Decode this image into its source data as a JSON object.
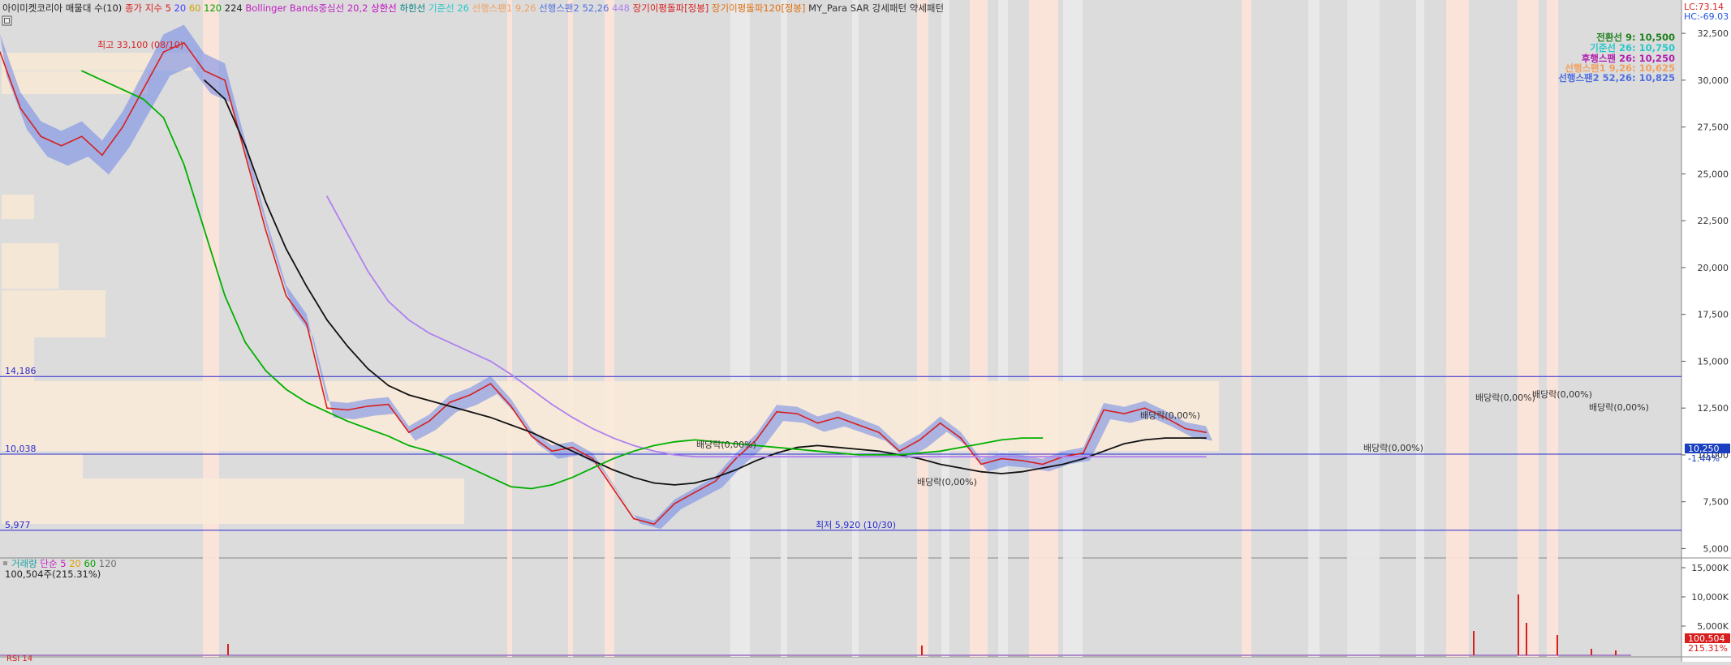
{
  "legend_top": [
    {
      "text": "아이미켓코리아 매물대 수(10)",
      "color": "#222222"
    },
    {
      "text": "종가 지수 5",
      "color": "#d81e1e"
    },
    {
      "text": "20",
      "color": "#4040ff"
    },
    {
      "text": "60",
      "color": "#d4a000"
    },
    {
      "text": "120",
      "color": "#00a000"
    },
    {
      "text": "224",
      "color": "#222222"
    },
    {
      "text": "Bollinger Bands중심선 20,2",
      "color": "#c020c0"
    },
    {
      "text": "상한선",
      "color": "#c000c0"
    },
    {
      "text": "하한선",
      "color": "#008080"
    },
    {
      "text": "기준선 26",
      "color": "#28c8c8"
    },
    {
      "text": "선행스팬1 9,26",
      "color": "#f0a060"
    },
    {
      "text": "선행스팬2 52,26",
      "color": "#5070e0"
    },
    {
      "text": "448",
      "color": "#b080f0"
    },
    {
      "text": "장기이평돌파[정봉]",
      "color": "#d81e1e"
    },
    {
      "text": "장기이평돌파120[정봉]",
      "color": "#e07010"
    },
    {
      "text": "MY_Para SAR 강세패턴",
      "color": "#333333"
    },
    {
      "text": "약세패턴",
      "color": "#333333"
    }
  ],
  "right_top_labels": [
    {
      "text": "LC:73.14",
      "color": "#d81e1e"
    },
    {
      "text": "HC:-69.03",
      "color": "#2050e0"
    }
  ],
  "ichimoku_box": [
    {
      "text": "전환선 9: 10,500",
      "color": "#208020"
    },
    {
      "text": "기준선 26: 10,750",
      "color": "#28c8c8"
    },
    {
      "text": "후행스팬 26: 10,250",
      "color": "#b020b0"
    },
    {
      "text": "선행스팬1 9,26: 10,625",
      "color": "#f0a060"
    },
    {
      "text": "선행스팬2 52,26: 10,825",
      "color": "#5070e0"
    }
  ],
  "annotations": {
    "high": "최고 33,100 (08/10)",
    "low": "최저 5,920 (10/30)",
    "dividends": [
      "배당락(0,00%)",
      "배당락(0,00%)",
      "배당락(0,00%)",
      "배당락(0,00%)",
      "배당락(0,00%)",
      "배당락(0,00%)",
      "배당락(0,00%)"
    ]
  },
  "hlines": [
    {
      "label": "14,186",
      "value": 14186
    },
    {
      "label": "10,038",
      "value": 10038
    },
    {
      "label": "5,977",
      "value": 5977
    }
  ],
  "price_axis": [
    "32,500",
    "30,000",
    "27,500",
    "25,000",
    "22,500",
    "20,000",
    "17,500",
    "15,000",
    "12,500",
    "10,000",
    "7,500",
    "5,000"
  ],
  "price_badge": {
    "value": "10,250",
    "change": "-1.44%"
  },
  "volume_legend": [
    {
      "text": "거래량",
      "color": "#20a0a0"
    },
    {
      "text": "단순 5",
      "color": "#c020c0"
    },
    {
      "text": "20",
      "color": "#e0a000"
    },
    {
      "text": "60",
      "color": "#00a000"
    },
    {
      "text": "120",
      "color": "#707070"
    }
  ],
  "volume_info": "100,504주(215.31%)",
  "volume_axis": [
    "15,000K",
    "10,000K",
    "5,000K"
  ],
  "volume_badge": {
    "value": "100,504",
    "change": "215.31%"
  },
  "bottom_legend": "RSI 14",
  "chart_data": {
    "type": "line",
    "title": "아이미켓코리아",
    "ylim": [
      4500,
      33500
    ],
    "y_ticks": [
      32500,
      30000,
      27500,
      25000,
      22500,
      20000,
      17500,
      15000,
      12500,
      10000,
      7500,
      5000
    ],
    "x": [
      0,
      25,
      50,
      75,
      100,
      125,
      150,
      175,
      200,
      225,
      250,
      275,
      300,
      325,
      350,
      375,
      400,
      425,
      450,
      475,
      500,
      525,
      550,
      575,
      600,
      625,
      650,
      675,
      700,
      725,
      750,
      775,
      800,
      825,
      850,
      875,
      900,
      925,
      950,
      975,
      1000,
      1025,
      1050,
      1075,
      1100,
      1125,
      1150,
      1175,
      1200,
      1225,
      1250,
      1275,
      1300,
      1325,
      1350,
      1375,
      1400,
      1425,
      1450,
      1475,
      1500,
      1525,
      1550,
      1575,
      1600,
      1625,
      1650,
      1675,
      1700,
      1725,
      1750,
      1775,
      1800,
      1825,
      1850,
      1875,
      1900,
      1925,
      1950,
      1975,
      2000
    ],
    "series": [
      {
        "name": "종가",
        "color": "#d81e1e",
        "values": [
          31500,
          28500,
          27000,
          26500,
          27000,
          26000,
          27500,
          29500,
          31500,
          32000,
          30500,
          30000,
          26000,
          22000,
          18500,
          17000,
          12500,
          12400,
          12600,
          12700,
          11200,
          11800,
          12800,
          13200,
          13800,
          12600,
          11000,
          10200,
          10400,
          9800,
          8200,
          6600,
          6300,
          7400,
          8000,
          8600,
          9800,
          10800,
          12300,
          12200,
          11700,
          12000,
          11600,
          11200,
          10200,
          10800,
          11700,
          10900,
          9500,
          9800,
          9700,
          9500,
          9900,
          10100,
          12400,
          12200,
          12500,
          12000,
          11400,
          11200
        ]
      },
      {
        "name": "224",
        "color": "#111111",
        "values": [
          null,
          null,
          null,
          null,
          null,
          null,
          null,
          null,
          null,
          null,
          30000,
          29000,
          26500,
          23500,
          21000,
          19000,
          17200,
          15800,
          14600,
          13700,
          13200,
          12900,
          12600,
          12300,
          12000,
          11600,
          11200,
          10700,
          10200,
          9700,
          9200,
          8800,
          8500,
          8400,
          8500,
          8800,
          9200,
          9700,
          10100,
          10400,
          10500,
          10400,
          10300,
          10200,
          10000,
          9800,
          9500,
          9300,
          9100,
          9000,
          9100,
          9300,
          9500,
          9800,
          10200,
          10600,
          10800,
          10900,
          10900,
          10900
        ]
      },
      {
        "name": "448",
        "color": "#b080f0",
        "values": [
          null,
          null,
          null,
          null,
          null,
          null,
          null,
          null,
          null,
          null,
          null,
          null,
          null,
          null,
          null,
          null,
          23800,
          21800,
          19800,
          18200,
          17200,
          16500,
          16000,
          15500,
          15000,
          14300,
          13500,
          12700,
          12000,
          11400,
          10900,
          10500,
          10200,
          10000,
          9900,
          9900,
          9900,
          9900,
          9900,
          9900,
          9900,
          9900,
          9900,
          9900,
          9900,
          9900,
          9900,
          9900,
          9900,
          9900,
          9900,
          9900,
          9900,
          9900,
          9900,
          9900,
          9900,
          9900,
          9900,
          9900
        ]
      },
      {
        "name": "120",
        "color": "#00b000",
        "values": [
          null,
          null,
          null,
          null,
          30500,
          30000,
          29500,
          29000,
          28000,
          25500,
          22000,
          18500,
          16000,
          14500,
          13500,
          12800,
          12300,
          11800,
          11400,
          11000,
          10500,
          10200,
          9800,
          9300,
          8800,
          8300,
          8200,
          8400,
          8800,
          9300,
          9800,
          10200,
          10500,
          10700,
          10800,
          10700,
          10600,
          10500,
          10400,
          10300,
          10200,
          10100,
          10000,
          10000,
          10000,
          10100,
          10200,
          10400,
          10600,
          10800,
          10900,
          10900
        ]
      }
    ]
  }
}
